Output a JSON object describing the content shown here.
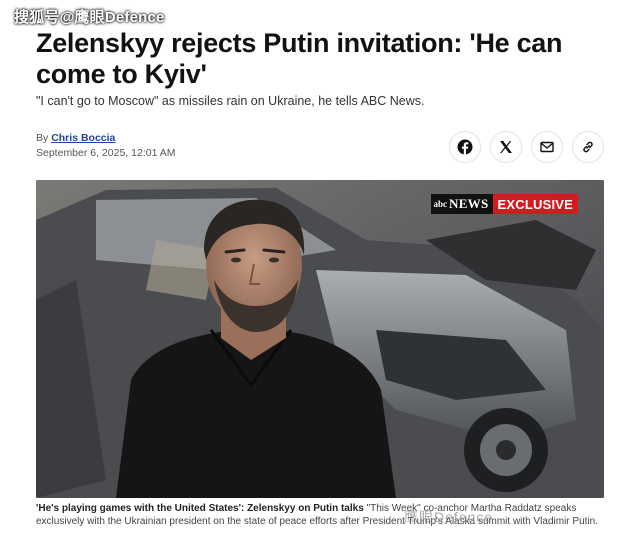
{
  "watermark_top": "搜狐号@鹰眼Defence",
  "headline": "Zelenskyy rejects Putin invitation: 'He can come to Kyiv'",
  "subheadline": "\"I can't go to Moscow\" as missiles rain on Ukraine, he tells ABC News.",
  "byline": {
    "prefix": "By",
    "author": "Chris Boccia",
    "date": "September 6, 2025, 12:01 AM"
  },
  "share_icons": [
    "facebook-icon",
    "x-icon",
    "mail-icon",
    "link-icon"
  ],
  "photo_badge": {
    "network": "NEWS",
    "label": "EXCLUSIVE"
  },
  "caption": {
    "bold": "'He's playing games with the United States': Zelenskyy on Putin talks",
    "text": "\"This Week\" co-anchor Martha Raddatz speaks exclusively with the Ukrainian president on the state of peace efforts after President Trump's Alaska summit with Vladimir Putin."
  },
  "watermark_bottom": "鹰眼Defence",
  "colors": {
    "author_link": "#1a4aa0",
    "exclusive_red": "#d7191f"
  }
}
